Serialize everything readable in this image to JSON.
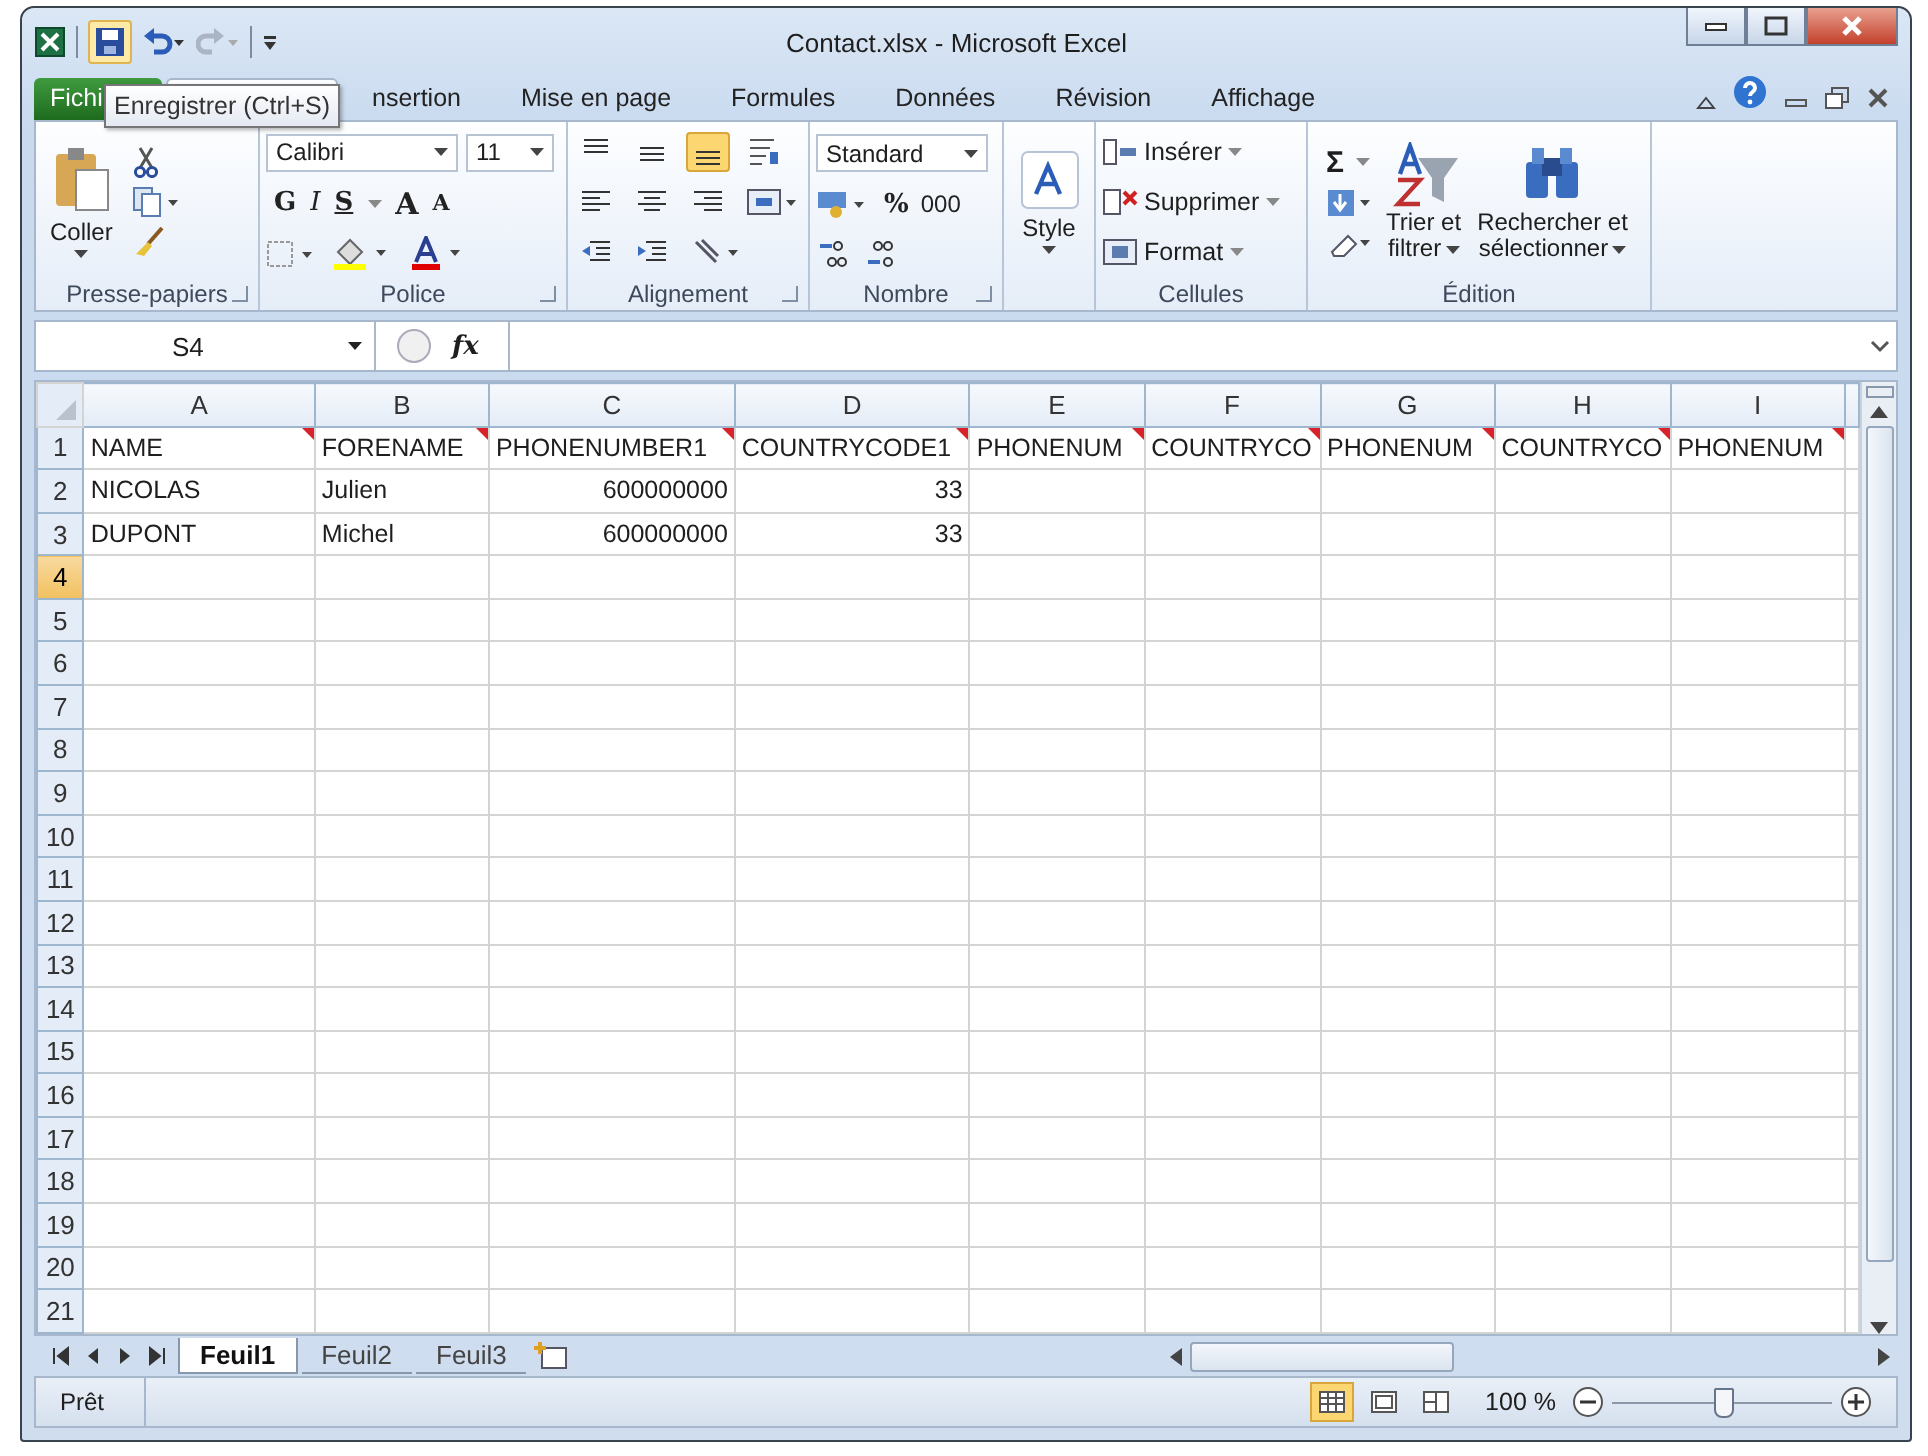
{
  "window": {
    "title": "Contact.xlsx - Microsoft Excel"
  },
  "tooltip": "Enregistrer (Ctrl+S)",
  "tabs": [
    {
      "label": "Fichi",
      "kind": "file",
      "selected": false
    },
    {
      "kind": "hidden",
      "selected": true
    },
    {
      "label": "nsertion",
      "kind": "tab",
      "selected": false
    },
    {
      "label": "Mise en page",
      "kind": "tab",
      "selected": false
    },
    {
      "label": "Formules",
      "kind": "tab",
      "selected": false
    },
    {
      "label": "Données",
      "kind": "tab",
      "selected": false
    },
    {
      "label": "Révision",
      "kind": "tab",
      "selected": false
    },
    {
      "label": "Affichage",
      "kind": "tab",
      "selected": false
    }
  ],
  "ribbon": {
    "clipboard": {
      "paste": "Coller",
      "label": "Presse-papiers"
    },
    "font": {
      "name": "Calibri",
      "size": "11",
      "bold": "G",
      "italic": "I",
      "underline": "S",
      "grow": "A",
      "shrink": "A",
      "label": "Police"
    },
    "alignment": {
      "label": "Alignement"
    },
    "number": {
      "format": "Standard",
      "percent": "%",
      "thousands": "000",
      "label": "Nombre"
    },
    "styles": {
      "button": "Style"
    },
    "cells": {
      "insert": "Insérer",
      "delete": "Supprimer",
      "format": "Format",
      "label": "Cellules"
    },
    "editing": {
      "sum": "Σ",
      "sort": [
        "Trier et",
        "filtrer"
      ],
      "find": [
        "Rechercher et",
        "sélectionner"
      ],
      "label": "Édition"
    }
  },
  "formula_bar": {
    "name_box": "S4",
    "function_label": "fx"
  },
  "sheet": {
    "columns": [
      {
        "label": "A",
        "selected": false
      },
      {
        "label": "B",
        "selected": false
      },
      {
        "label": "C",
        "selected": false
      },
      {
        "label": "D",
        "selected": false
      },
      {
        "label": "E",
        "selected": false
      },
      {
        "label": "F",
        "selected": false
      },
      {
        "label": "G",
        "selected": false
      },
      {
        "label": "H",
        "selected": false
      },
      {
        "label": "I",
        "selected": false
      }
    ],
    "rows": [
      {
        "header": "1",
        "selected": false,
        "cells": [
          {
            "text": "NAME",
            "comment": true
          },
          {
            "text": "FORENAME",
            "comment": true
          },
          {
            "text": "PHONENUMBER1",
            "comment": true
          },
          {
            "text": "COUNTRYCODE1",
            "comment": true
          },
          {
            "text": "PHONENUM",
            "comment": true
          },
          {
            "text": "COUNTRYCO",
            "comment": true
          },
          {
            "text": "PHONENUM",
            "comment": true
          },
          {
            "text": "COUNTRYCO",
            "comment": true
          },
          {
            "text": "PHONENUM",
            "comment": true
          }
        ]
      },
      {
        "header": "2",
        "selected": false,
        "cells": [
          {
            "text": "NICOLAS"
          },
          {
            "text": "Julien"
          },
          {
            "text": "600000000",
            "kind": "number"
          },
          {
            "text": "33",
            "kind": "number"
          }
        ]
      },
      {
        "header": "3",
        "selected": false,
        "cells": [
          {
            "text": "DUPONT"
          },
          {
            "text": "Michel"
          },
          {
            "text": "600000000",
            "kind": "number"
          },
          {
            "text": "33",
            "kind": "number"
          }
        ]
      },
      {
        "header": "4",
        "selected": true
      },
      {
        "header": "5",
        "selected": false
      },
      {
        "header": "6",
        "selected": false
      },
      {
        "header": "7",
        "selected": false
      },
      {
        "header": "8",
        "selected": false
      },
      {
        "header": "9",
        "selected": false
      },
      {
        "header": "10",
        "selected": false
      },
      {
        "header": "11",
        "selected": false
      },
      {
        "header": "12",
        "selected": false
      },
      {
        "header": "13",
        "selected": false
      },
      {
        "header": "14",
        "selected": false
      },
      {
        "header": "15",
        "selected": false
      },
      {
        "header": "16",
        "selected": false
      },
      {
        "header": "17",
        "selected": false
      },
      {
        "header": "18",
        "selected": false
      },
      {
        "header": "19",
        "selected": false
      },
      {
        "header": "20",
        "selected": false
      },
      {
        "header": "21",
        "selected": false
      }
    ]
  },
  "sheet_tabs": [
    {
      "label": "Feuil1",
      "selected": true
    },
    {
      "label": "Feuil2",
      "selected": false
    },
    {
      "label": "Feuil3",
      "selected": false
    }
  ],
  "status_bar": {
    "status": "Prêt",
    "zoom": "100 %",
    "zoom_slider": {
      "level": 0.5
    }
  }
}
